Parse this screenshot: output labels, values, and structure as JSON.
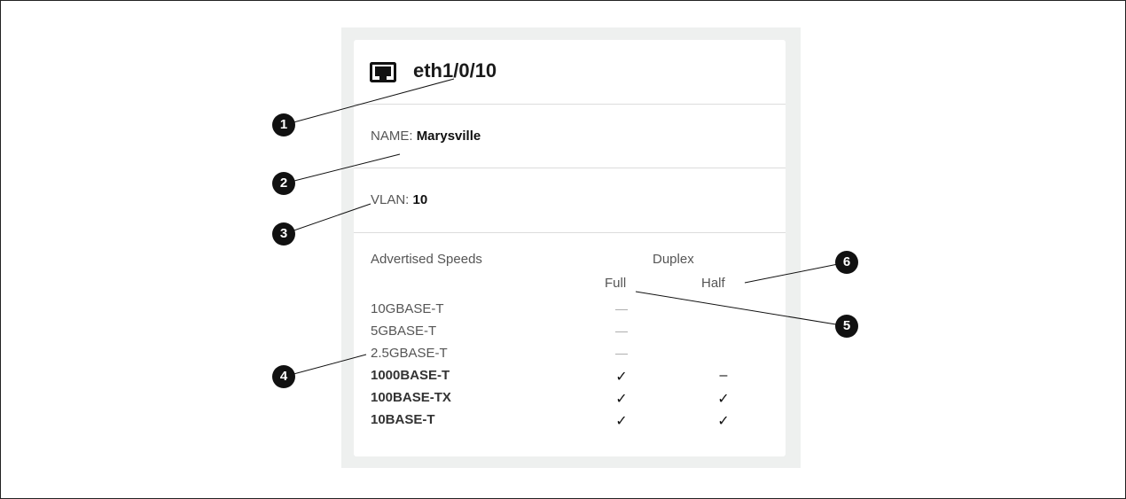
{
  "port": {
    "name": "eth1/0/10",
    "icon": "ethernet-port-icon"
  },
  "name_field": {
    "label": "NAME: ",
    "value": "Marysville"
  },
  "vlan_field": {
    "label": "VLAN: ",
    "value": "10"
  },
  "speeds": {
    "title": "Advertised Speeds",
    "duplex_title": "Duplex",
    "full_label": "Full",
    "half_label": "Half",
    "rows": [
      {
        "name": "10GBASE-T",
        "full": "—",
        "half": ""
      },
      {
        "name": "5GBASE-T",
        "full": "—",
        "half": ""
      },
      {
        "name": "2.5GBASE-T",
        "full": "—",
        "half": ""
      },
      {
        "name": "1000BASE-T",
        "full": "✓",
        "half": "–"
      },
      {
        "name": "100BASE-TX",
        "full": "✓",
        "half": "✓"
      },
      {
        "name": "10BASE-T",
        "full": "✓",
        "half": "✓"
      }
    ]
  },
  "callouts": [
    "1",
    "2",
    "3",
    "4",
    "5",
    "6"
  ]
}
